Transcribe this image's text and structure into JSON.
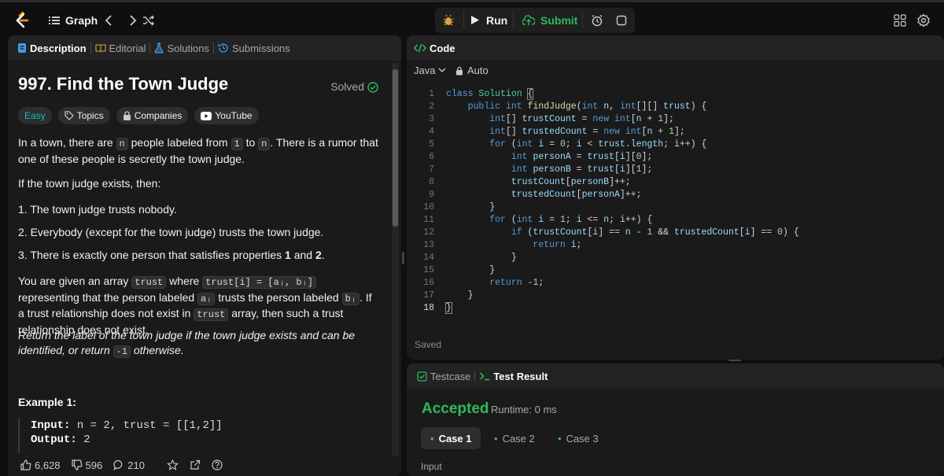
{
  "topbar": {
    "problem_list_label": "Graph",
    "run_label": "Run",
    "submit_label": "Submit"
  },
  "description_tabs": [
    {
      "label": "Description"
    },
    {
      "label": "Editorial"
    },
    {
      "label": "Solutions"
    },
    {
      "label": "Submissions"
    }
  ],
  "problem": {
    "title": "997. Find the Town Judge",
    "status": "Solved",
    "difficulty": "Easy",
    "tags": [
      "Topics",
      "Companies",
      "YouTube"
    ],
    "p1_a": "In a town, there are ",
    "p1_code1": "n",
    "p1_b": " people labeled from ",
    "p1_code2": "1",
    "p1_c": " to ",
    "p1_code3": "n",
    "p1_d": ". There is a rumor that one of these people is secretly the town judge.",
    "p2": "If the town judge exists, then:",
    "li1": "1. The town judge trusts nobody.",
    "li2": "2. Everybody (except for the town judge) trusts the town judge.",
    "li3_a": "3. There is exactly one person that satisfies properties ",
    "li3_b1": "1",
    "li3_c": " and ",
    "li3_b2": "2",
    "li3_d": ".",
    "p4_a": "You are given an array ",
    "p4_code1": "trust",
    "p4_b": " where ",
    "p4_code2": "trust[i] = [aᵢ, bᵢ]",
    "p4_c": " representing that the person labeled ",
    "p4_code3": "aᵢ",
    "p4_d": " trusts the person labeled ",
    "p4_code4": "bᵢ",
    "p4_e": ". If a trust relationship does not exist in ",
    "p4_code5": "trust",
    "p4_f": " array, then such a trust relationship does not exist.",
    "p5_a": "Return the label of the town judge if the town judge exists and can be identified, or return ",
    "p5_code": "-1",
    "p5_b": " otherwise.",
    "example_title": "Example 1:",
    "example_input_label": "Input:",
    "example_input": "n = 2, trust = [[1,2]]",
    "example_output_label": "Output:",
    "example_output": "2"
  },
  "footer": {
    "likes": "6,628",
    "dislikes": "596",
    "comments": "210"
  },
  "code_panel": {
    "title": "Code",
    "language": "Java",
    "mode": "Auto",
    "status": "Saved",
    "line_numbers": [
      "1",
      "2",
      "3",
      "4",
      "5",
      "6",
      "7",
      "8",
      "9",
      "10",
      "11",
      "12",
      "13",
      "14",
      "15",
      "16",
      "17",
      "18"
    ]
  },
  "result_panel": {
    "tabs": [
      {
        "label": "Testcase"
      },
      {
        "label": "Test Result"
      }
    ],
    "verdict": "Accepted",
    "runtime": "Runtime: 0 ms",
    "cases": [
      "Case 1",
      "Case 2",
      "Case 3"
    ],
    "input_label": "Input"
  },
  "colors": {
    "accepted_green": "#2cbb5d",
    "easy_teal": "#1cbaba",
    "accent_blue": "#3e9bf0",
    "solved_green": "#2cbb5d"
  }
}
